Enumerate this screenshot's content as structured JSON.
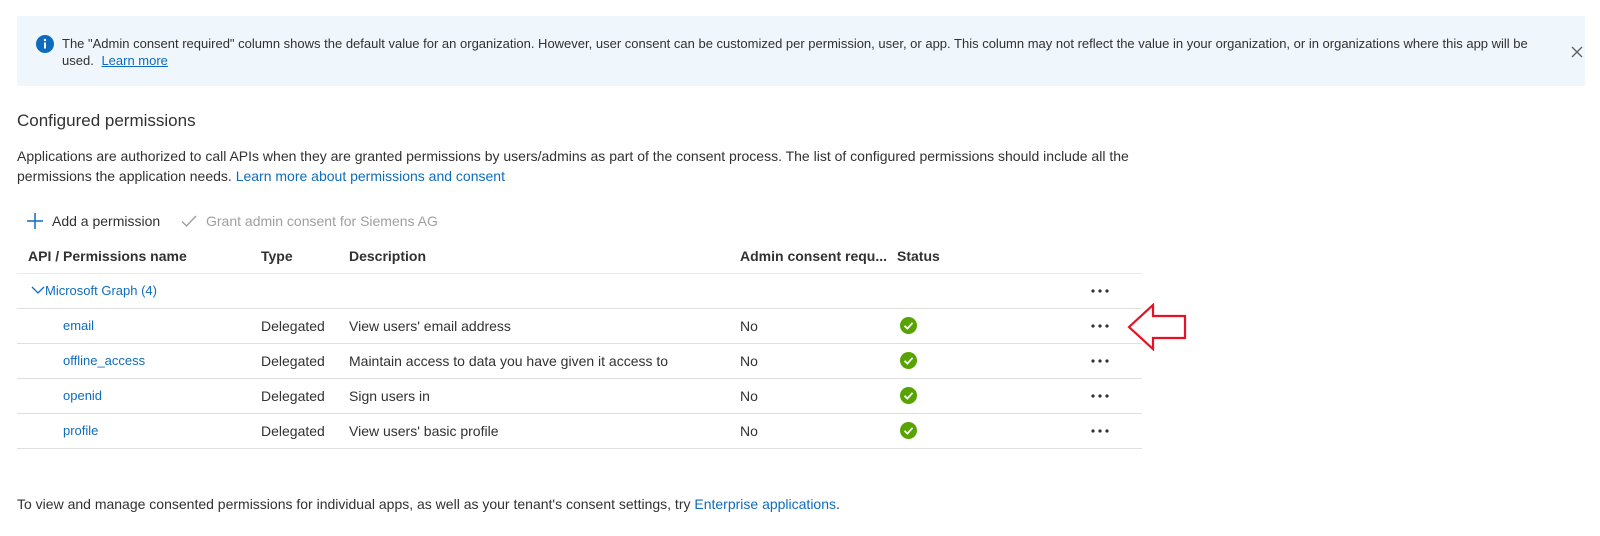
{
  "banner": {
    "text": "The \"Admin consent required\" column shows the default value for an organization. However, user consent can be customized per permission, user, or app. This column may not reflect the value in your organization, or in organizations where this app will be used.",
    "link": "Learn more",
    "icon": "info-icon",
    "close_icon": "close-icon"
  },
  "section": {
    "title": "Configured permissions",
    "description": "Applications are authorized to call APIs when they are granted permissions by users/admins as part of the consent process. The list of configured permissions should include all the permissions the application needs.",
    "link": "Learn more about permissions and consent"
  },
  "toolbar": {
    "add_label": "Add a permission",
    "grant_label": "Grant admin consent for Siemens AG"
  },
  "table": {
    "headers": [
      "API / Permissions name",
      "Type",
      "Description",
      "Admin consent requ...",
      "Status"
    ],
    "group": "Microsoft Graph (4)",
    "rows": [
      {
        "name": "email",
        "type": "Delegated",
        "description": "View users' email address",
        "admin": "No",
        "status": "granted"
      },
      {
        "name": "offline_access",
        "type": "Delegated",
        "description": "Maintain access to data you have given it access to",
        "admin": "No",
        "status": "granted"
      },
      {
        "name": "openid",
        "type": "Delegated",
        "description": "Sign users in",
        "admin": "No",
        "status": "granted"
      },
      {
        "name": "profile",
        "type": "Delegated",
        "description": "View users' basic profile",
        "admin": "No",
        "status": "granted"
      }
    ]
  },
  "footer": {
    "text": "To view and manage consented permissions for individual apps, as well as your tenant's consent settings, try",
    "link": "Enterprise applications",
    "suffix": "."
  },
  "colors": {
    "accent": "#0f6cbd",
    "banner_bg": "#eff6fc",
    "success": "#57a300",
    "annotation": "#e81123"
  }
}
